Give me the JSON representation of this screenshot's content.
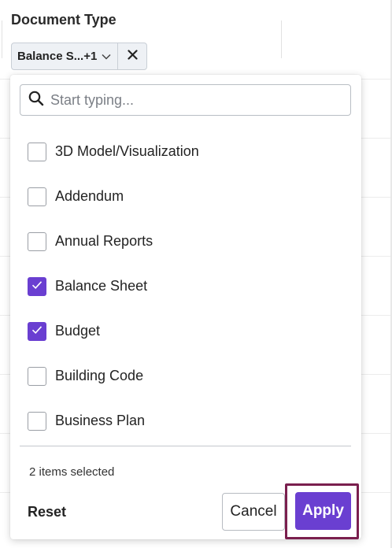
{
  "column_header": {
    "title": "Document Type"
  },
  "filter_chip": {
    "label": "Balance S...+1"
  },
  "search": {
    "placeholder": "Start typing..."
  },
  "options": [
    {
      "label": "3D Model/Visualization",
      "checked": false
    },
    {
      "label": "Addendum",
      "checked": false
    },
    {
      "label": "Annual Reports",
      "checked": false
    },
    {
      "label": "Balance Sheet",
      "checked": true
    },
    {
      "label": "Budget",
      "checked": true
    },
    {
      "label": "Building Code",
      "checked": false
    },
    {
      "label": "Business Plan",
      "checked": false
    }
  ],
  "footer": {
    "selected_count": "2 items selected",
    "reset_label": "Reset",
    "cancel_label": "Cancel",
    "apply_label": "Apply"
  },
  "colors": {
    "accent": "#6a3fd1",
    "highlight_border": "#7a1f4e",
    "chip_background": "#eef1f5"
  }
}
